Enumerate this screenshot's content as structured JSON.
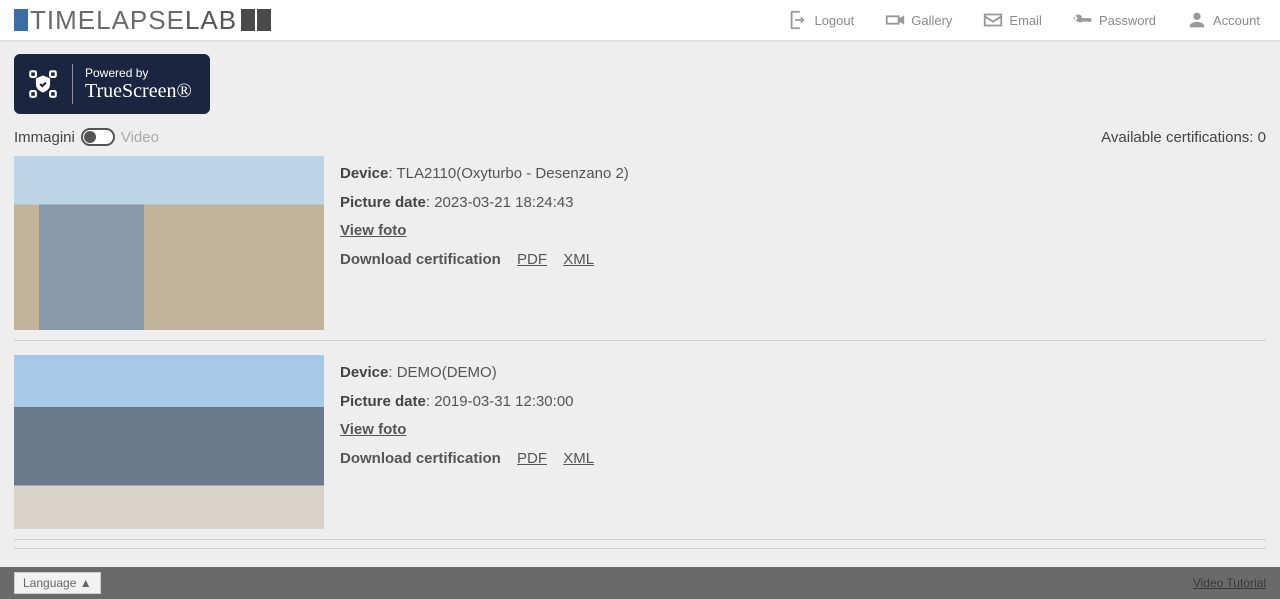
{
  "header": {
    "logo_part1": "TIMELAPSE",
    "logo_part2": "LAB",
    "nav": {
      "logout": "Logout",
      "gallery": "Gallery",
      "email": "Email",
      "password": "Password",
      "account": "Account"
    }
  },
  "badge": {
    "powered_by": "Powered by",
    "name": "TrueScreen®"
  },
  "filter": {
    "immagini": "Immagini",
    "video": "Video",
    "available_cert_label": "Available certifications:",
    "available_cert_count": "0"
  },
  "labels": {
    "device": "Device",
    "picture_date": "Picture date",
    "view_foto": "View foto",
    "download_cert": "Download certification",
    "pdf": "PDF",
    "xml": "XML"
  },
  "entries": [
    {
      "device": "TLA2110(Oxyturbo - Desenzano 2)",
      "date": "2023-03-21 18:24:43"
    },
    {
      "device": "DEMO(DEMO)",
      "date": "2019-03-31 12:30:00"
    }
  ],
  "footer": {
    "language": "Language ▲",
    "tutorial": "Video Tutorial"
  }
}
